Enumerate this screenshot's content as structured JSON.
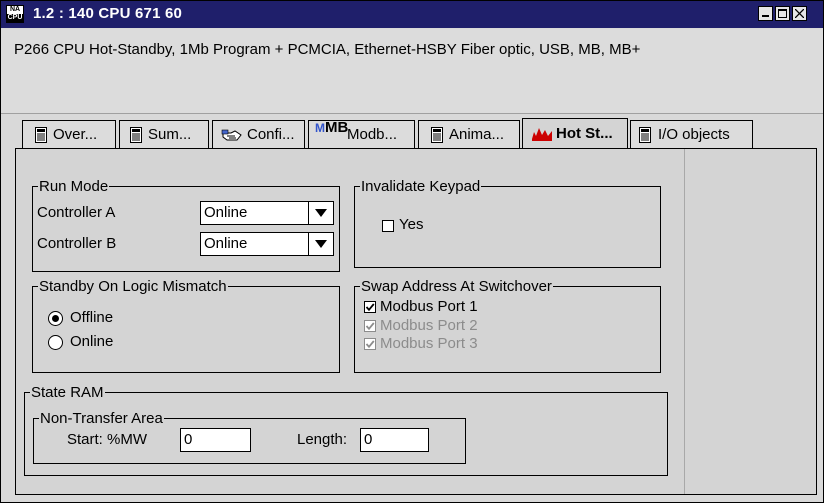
{
  "window": {
    "icon_top": "NA",
    "icon_bottom": "CPU",
    "title": "1.2 : 140 CPU 671 60",
    "buttons": [
      "minimize-button",
      "maximize-button",
      "close-button"
    ]
  },
  "description": "P266 CPU Hot-Standby, 1Mb Program + PCMCIA, Ethernet-HSBY Fiber optic, USB, MB, MB+",
  "tabs": [
    {
      "label": "Over...",
      "icon": "module-icon",
      "active": false
    },
    {
      "label": "Sum...",
      "icon": "module-icon",
      "active": false
    },
    {
      "label": "Confi...",
      "icon": "config-hand-icon",
      "active": false
    },
    {
      "label": "Modb...",
      "icon": "modbus-mb-icon",
      "icon_text": "MB",
      "active": false
    },
    {
      "label": "Anima...",
      "icon": "module-icon",
      "active": false
    },
    {
      "label": "Hot St...",
      "icon": "hot-standby-icon",
      "active": true
    },
    {
      "label": "I/O objects",
      "icon": "module-icon",
      "active": false
    }
  ],
  "run_mode": {
    "legend": "Run Mode",
    "controller_a": {
      "label": "Controller A",
      "value": "Online"
    },
    "controller_b": {
      "label": "Controller B",
      "value": "Online"
    }
  },
  "invalidate_keypad": {
    "legend": "Invalidate Keypad",
    "yes": {
      "label": "Yes",
      "checked": false
    }
  },
  "standby_logic_mismatch": {
    "legend": "Standby On Logic Mismatch",
    "options": [
      {
        "label": "Offline",
        "selected": true
      },
      {
        "label": "Online",
        "selected": false
      }
    ]
  },
  "swap_address": {
    "legend": "Swap Address At Switchover",
    "ports": [
      {
        "label": "Modbus Port 1",
        "checked": true,
        "enabled": true
      },
      {
        "label": "Modbus Port 2",
        "checked": true,
        "enabled": false
      },
      {
        "label": "Modbus Port 3",
        "checked": true,
        "enabled": false
      }
    ]
  },
  "state_ram": {
    "legend": "State RAM",
    "non_transfer": {
      "legend": "Non-Transfer Area",
      "start_label": "Start: %MW",
      "start_value": "0",
      "length_label": "Length:",
      "length_value": "0"
    }
  },
  "colors": {
    "titlebar": "#1f1f6b",
    "background": "#d4d4d4",
    "hot_standby_icon": "#cc0000",
    "modbus_icon_m": "#3355cc"
  }
}
